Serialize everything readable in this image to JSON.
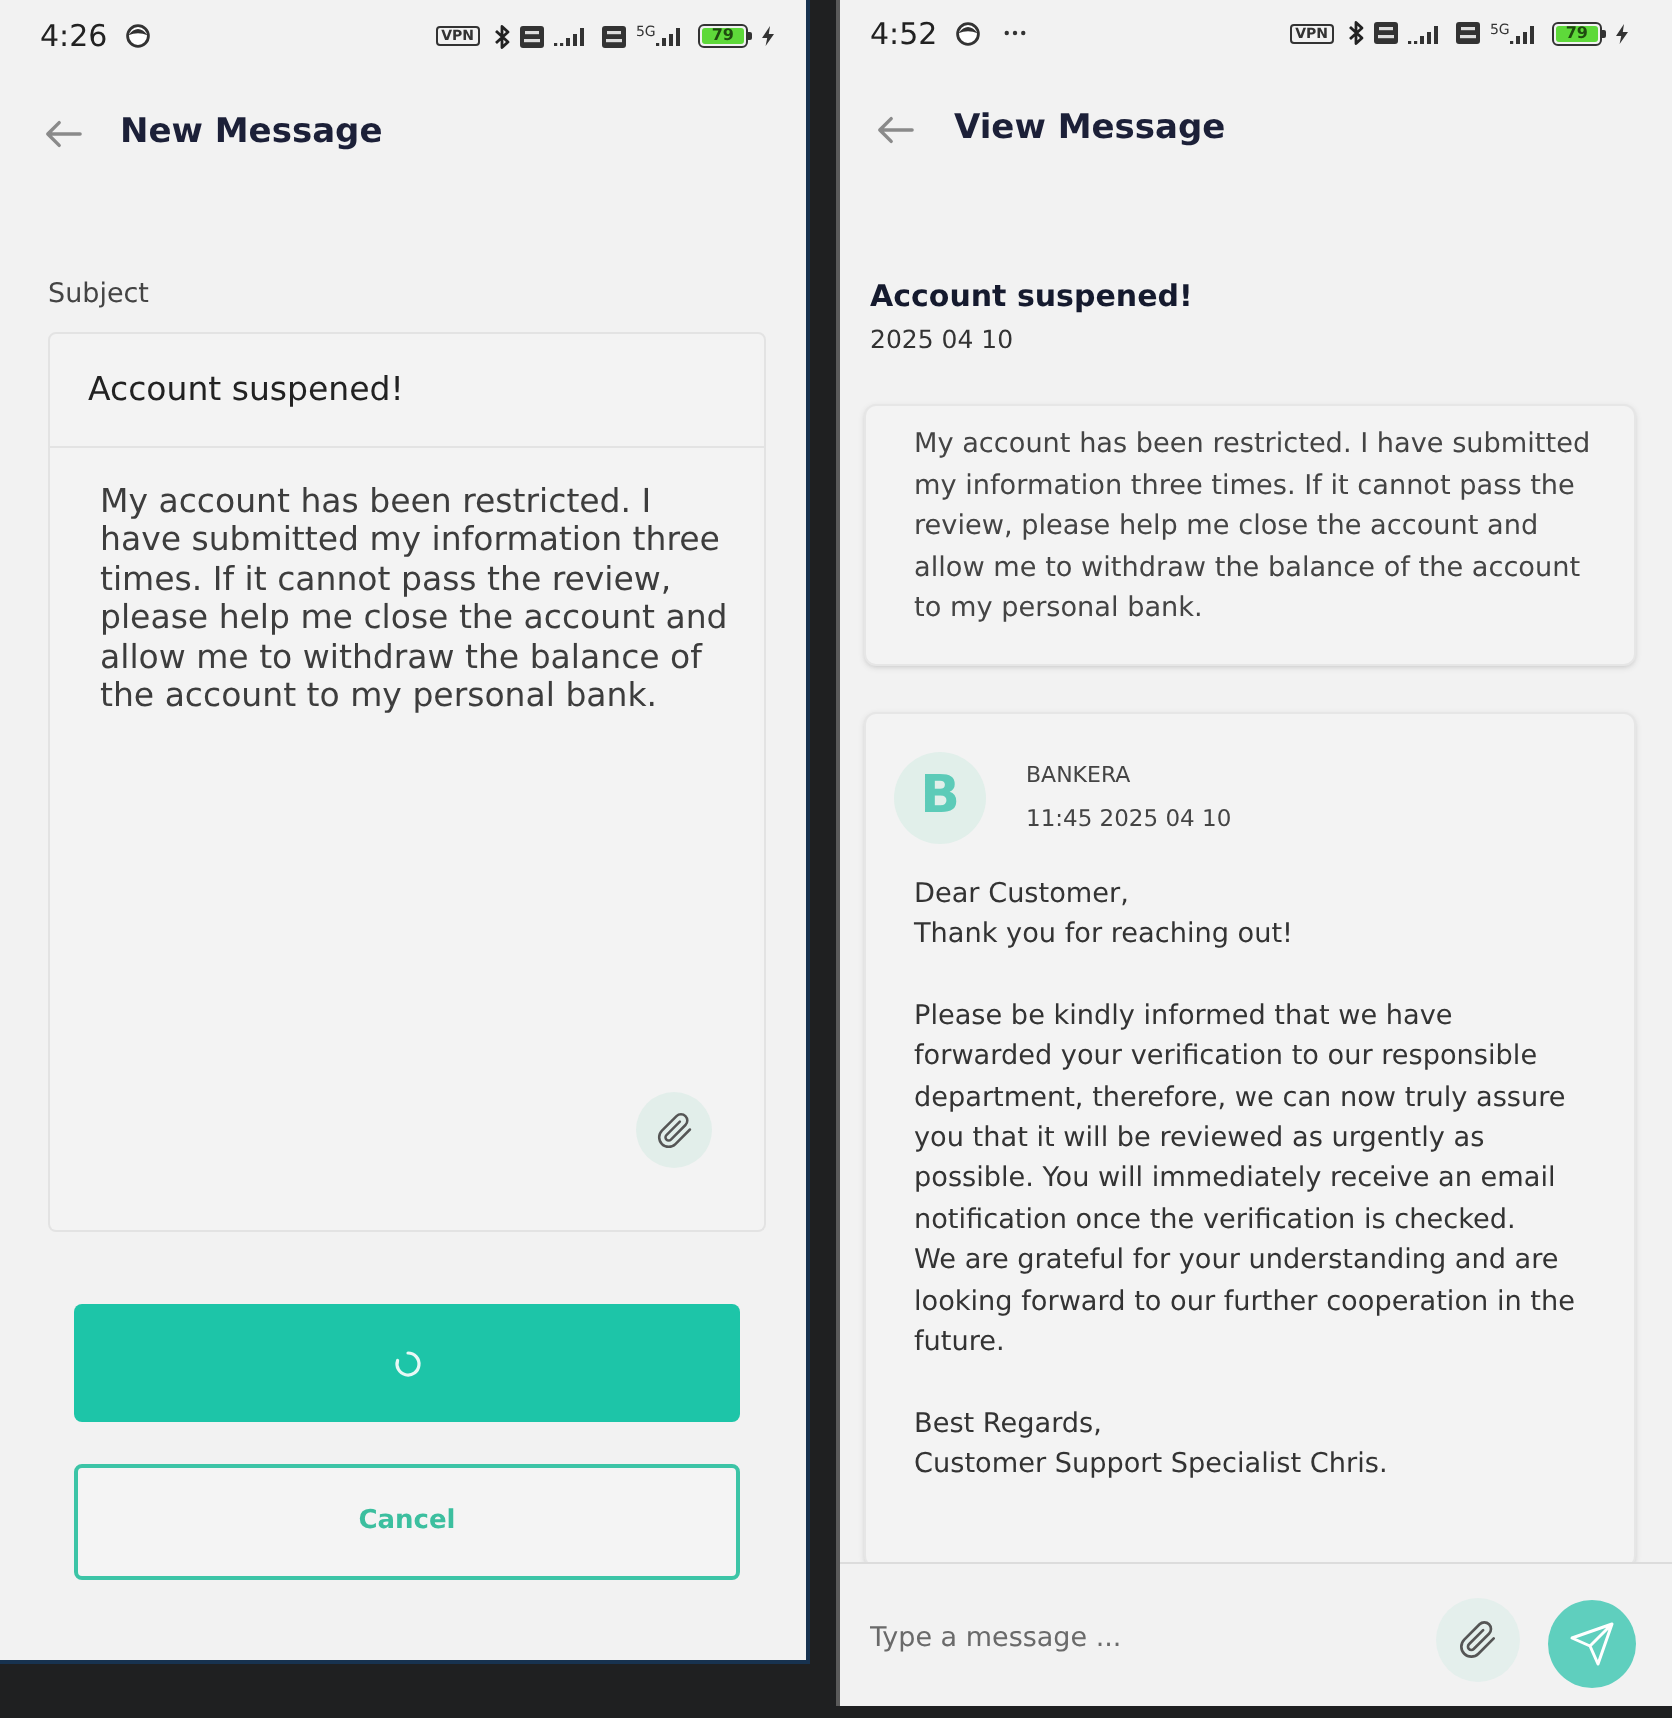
{
  "screens": [
    {
      "kind": "compose",
      "status_bar": {
        "time": "4:26",
        "vpn": "VPN",
        "network": "5G",
        "battery": "79"
      },
      "title": "New Message",
      "subject_label": "Subject",
      "subject_value": "Account suspened!",
      "message_value": "My account has been restricted. I have submitted my information three times. If it cannot pass the review, please help me close the account and allow me to withdraw the balance of the account to my personal bank.",
      "submit_button": {
        "loading": true
      },
      "cancel_button": "Cancel"
    },
    {
      "kind": "view",
      "status_bar": {
        "time": "4:52",
        "more_notifications": true,
        "vpn": "VPN",
        "network": "5G",
        "battery": "79"
      },
      "title": "View Message",
      "subject": "Account suspened!",
      "date": "2025 04 10",
      "messages": [
        {
          "kind": "sent",
          "paragraphs": [
            "My account has been restricted. I have submitted my information three times. If it cannot pass the review, please help me close the account and allow me to withdraw the balance of the account to my personal bank."
          ]
        },
        {
          "kind": "received",
          "avatar": "B",
          "sender": "BANKERA",
          "time": "11:45 2025 04 10",
          "paragraphs": [
            "Dear Customer,\nThank you for reaching out!",
            "Please be kindly informed that we have forwarded your verification to our responsible department, therefore, we can now truly assure you that it will be reviewed as urgently as possible. You will immediately receive an email notification once the verification is checked.\nWe are grateful for your understanding and are looking forward to our further cooperation in the future.",
            "Best Regards,\nCustomer Support Specialist Chris."
          ]
        }
      ],
      "composer": {
        "placeholder": "Type a message ..."
      }
    }
  ]
}
